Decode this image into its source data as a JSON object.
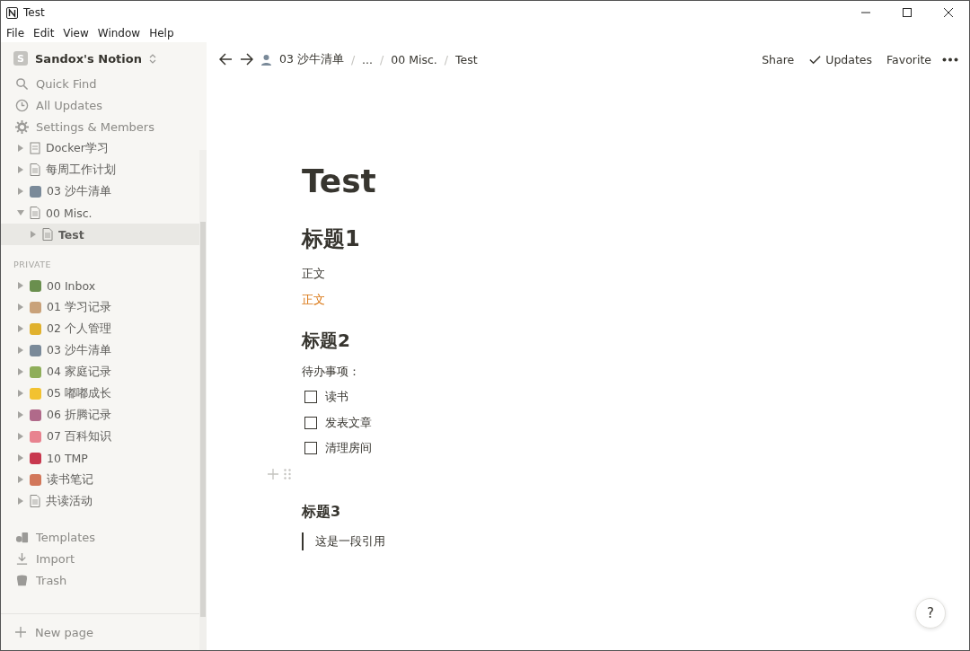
{
  "window": {
    "title": "Test"
  },
  "menu": [
    "File",
    "Edit",
    "View",
    "Window",
    "Help"
  ],
  "sidebar": {
    "workspace": "Sandox's Notion",
    "workspace_initial": "S",
    "actions": [
      {
        "kind": "search",
        "label": "Quick Find"
      },
      {
        "kind": "clock",
        "label": "All Updates"
      },
      {
        "kind": "gear",
        "label": "Settings & Members"
      }
    ],
    "workspace_pages": [
      {
        "label": "Docker学习",
        "kind": "list",
        "expanded": false,
        "selected": false
      },
      {
        "label": "每周工作计划",
        "kind": "page",
        "expanded": false,
        "selected": false
      },
      {
        "label": "03 沙牛清单",
        "kind": "emoji",
        "color": "#7a8a99",
        "expanded": false,
        "selected": false
      },
      {
        "label": "00 Misc.",
        "kind": "page",
        "expanded": true,
        "selected": false,
        "children": [
          {
            "label": "Test",
            "kind": "page",
            "expanded": false,
            "selected": true
          }
        ]
      }
    ],
    "section_label": "PRIVATE",
    "private_pages": [
      {
        "label": "00 Inbox",
        "kind": "emoji",
        "color": "#6a8f4e",
        "expanded": false,
        "selected": false
      },
      {
        "label": "01 学习记录",
        "kind": "emoji",
        "color": "#c9a27a",
        "expanded": false,
        "selected": false
      },
      {
        "label": "02 个人管理",
        "kind": "emoji",
        "color": "#e0b12e",
        "expanded": false,
        "selected": false
      },
      {
        "label": "03 沙牛清单",
        "kind": "emoji",
        "color": "#7a8a99",
        "expanded": false,
        "selected": false
      },
      {
        "label": "04 家庭记录",
        "kind": "emoji",
        "color": "#8fae5a",
        "expanded": false,
        "selected": false
      },
      {
        "label": "05 嘟嘟成长",
        "kind": "emoji",
        "color": "#f2c230",
        "expanded": false,
        "selected": false
      },
      {
        "label": "06 折腾记录",
        "kind": "emoji",
        "color": "#b06a8a",
        "expanded": false,
        "selected": false
      },
      {
        "label": "07 百科知识",
        "kind": "emoji",
        "color": "#e8838f",
        "expanded": false,
        "selected": false
      },
      {
        "label": "10 TMP",
        "kind": "emoji",
        "color": "#c8384e",
        "expanded": false,
        "selected": false
      },
      {
        "label": "读书笔记",
        "kind": "emoji",
        "color": "#d2775a",
        "expanded": false,
        "selected": false
      },
      {
        "label": "共读活动",
        "kind": "page",
        "expanded": false,
        "selected": false
      }
    ],
    "tools": [
      {
        "kind": "templates",
        "label": "Templates"
      },
      {
        "kind": "import",
        "label": "Import"
      },
      {
        "kind": "trash",
        "label": "Trash"
      }
    ],
    "new_page": "New page"
  },
  "topbar": {
    "breadcrumbs": [
      "03 沙牛清单",
      "...",
      "00 Misc.",
      "Test"
    ],
    "separators": [
      "/",
      "/",
      "/"
    ],
    "actions": [
      {
        "kind": "text",
        "label": "Share"
      },
      {
        "kind": "check",
        "label": "Updates"
      },
      {
        "kind": "text",
        "label": "Favorite"
      }
    ]
  },
  "page": {
    "title": "Test",
    "blocks": [
      {
        "kind": "h1",
        "text": "标题1"
      },
      {
        "kind": "text",
        "text": "正文"
      },
      {
        "kind": "text",
        "text": "正文",
        "color": "#d9730d"
      },
      {
        "kind": "h2",
        "text": "标题2"
      },
      {
        "kind": "text",
        "text": "待办事项："
      },
      {
        "kind": "todo",
        "text": "读书",
        "checked": false
      },
      {
        "kind": "todo",
        "text": "发表文章",
        "checked": false
      },
      {
        "kind": "todo",
        "text": "清理房间",
        "checked": false
      },
      {
        "kind": "empty"
      },
      {
        "kind": "h3",
        "text": "标题3"
      },
      {
        "kind": "quote",
        "text": "这是一段引用"
      }
    ]
  },
  "help": "?"
}
